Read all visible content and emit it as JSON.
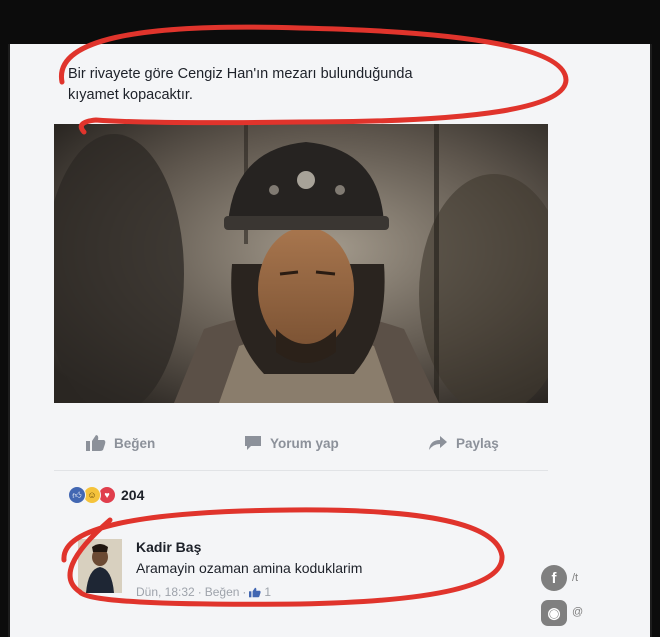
{
  "post": {
    "text_line1": "Bir rivayete göre Cengiz Han'ın mezarı bulunduğunda",
    "text_line2": "kıyamet kopacaktır."
  },
  "actions": {
    "like": "Beğen",
    "comment": "Yorum yap",
    "share": "Paylaş"
  },
  "reactions": {
    "count": "204",
    "icons": [
      "like-icon",
      "laugh-icon",
      "love-icon"
    ]
  },
  "comment": {
    "author": "Kadir Baş",
    "text": "Aramayin ozaman amina koduklarim",
    "time": "Dün, 18:32",
    "sep1": "·",
    "like": "Beğen",
    "sep2": "·",
    "like_count": "1"
  },
  "watermark": {
    "facebook_label": "/t",
    "instagram_label": "@"
  },
  "colors": {
    "annotation_red": "#e0342c",
    "accent": "#4267b2",
    "muted": "#8c919a"
  }
}
